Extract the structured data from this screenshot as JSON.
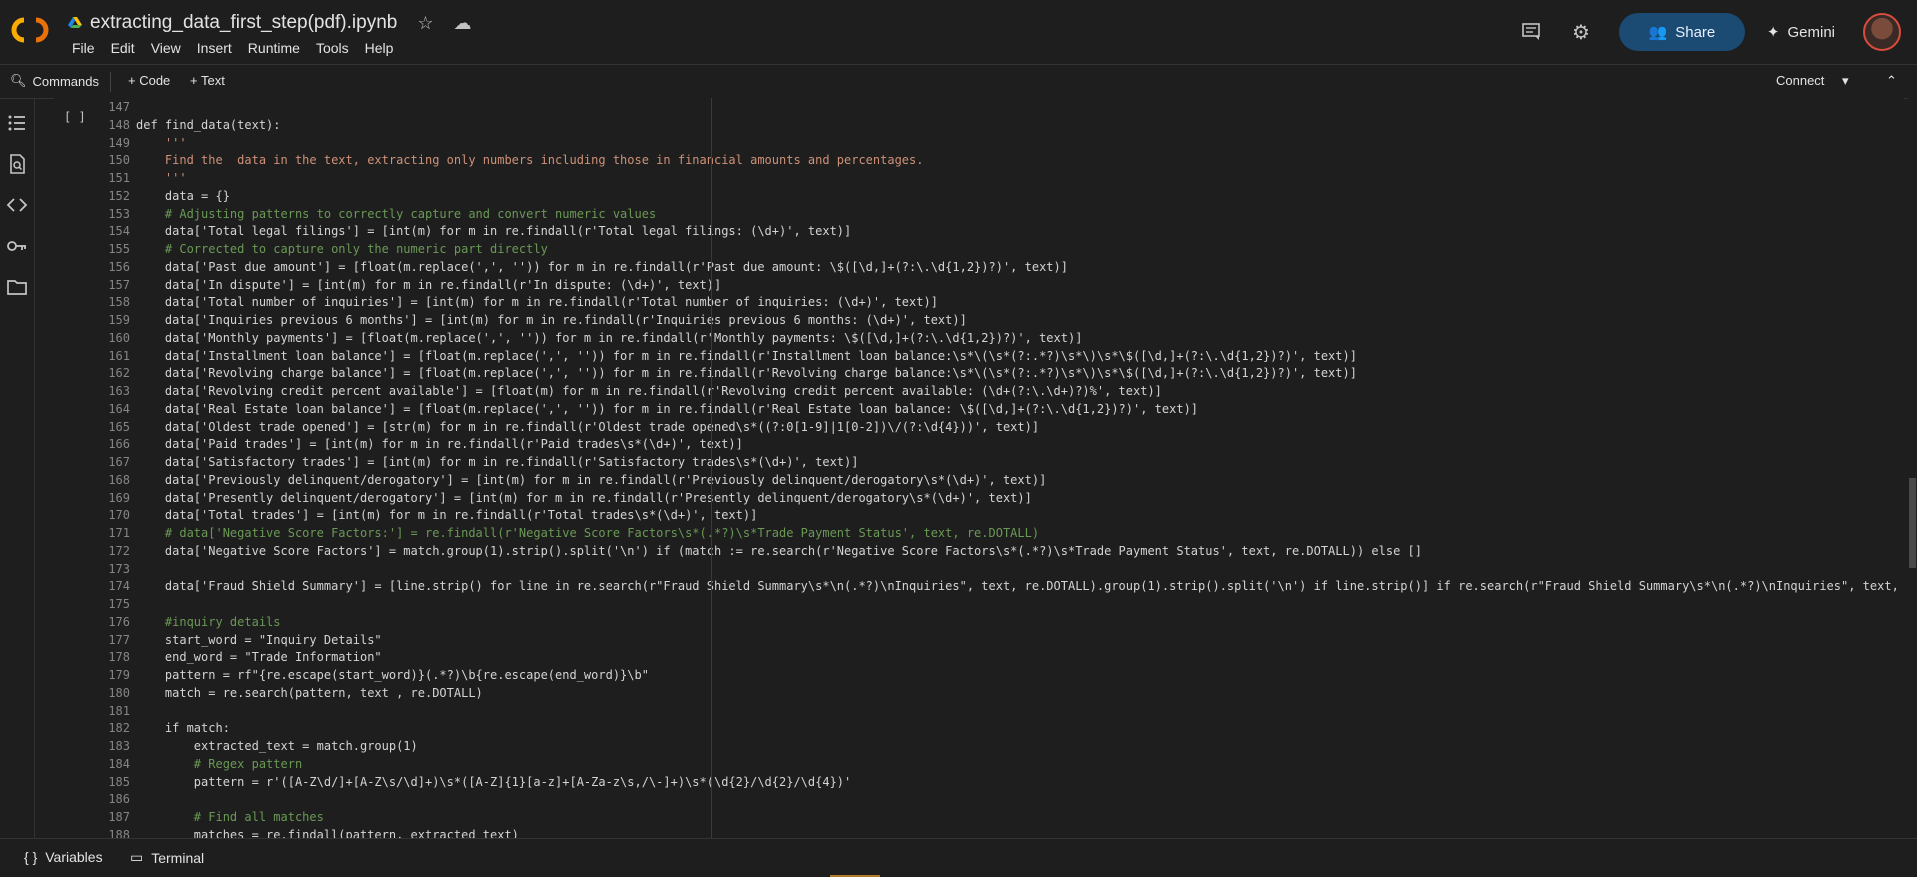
{
  "app": {
    "notebook_title": "extracting_data_first_step(pdf).ipynb",
    "menu": [
      "File",
      "Edit",
      "View",
      "Insert",
      "Runtime",
      "Tools",
      "Help"
    ],
    "share_label": "Share",
    "gemini_label": "Gemini"
  },
  "toolbar": {
    "commands_label": "Commands",
    "code_label": "+ Code",
    "text_label": "+ Text",
    "connect_label": "Connect"
  },
  "cell": {
    "run_indicator": "[ ]",
    "lines": [
      {
        "n": "147",
        "t": ""
      },
      {
        "n": "148",
        "t": "def find_data(text):"
      },
      {
        "n": "149",
        "t": "    '''"
      },
      {
        "n": "150",
        "t": "    Find the  data in the text, extracting only numbers including those in financial amounts and percentages."
      },
      {
        "n": "151",
        "t": "    '''"
      },
      {
        "n": "152",
        "t": "    data = {}"
      },
      {
        "n": "153",
        "t": "    # Adjusting patterns to correctly capture and convert numeric values"
      },
      {
        "n": "154",
        "t": "    data['Total legal filings'] = [int(m) for m in re.findall(r'Total legal filings: (\\d+)', text)]"
      },
      {
        "n": "155",
        "t": "    # Corrected to capture only the numeric part directly"
      },
      {
        "n": "156",
        "t": "    data['Past due amount'] = [float(m.replace(',', '')) for m in re.findall(r'Past due amount: \\$([\\d,]+(?:\\.\\d{1,2})?)', text)]"
      },
      {
        "n": "157",
        "t": "    data['In dispute'] = [int(m) for m in re.findall(r'In dispute: (\\d+)', text)]"
      },
      {
        "n": "158",
        "t": "    data['Total number of inquiries'] = [int(m) for m in re.findall(r'Total number of inquiries: (\\d+)', text)]"
      },
      {
        "n": "159",
        "t": "    data['Inquiries previous 6 months'] = [int(m) for m in re.findall(r'Inquiries previous 6 months: (\\d+)', text)]"
      },
      {
        "n": "160",
        "t": "    data['Monthly payments'] = [float(m.replace(',', '')) for m in re.findall(r'Monthly payments: \\$([\\d,]+(?:\\.\\d{1,2})?)', text)]"
      },
      {
        "n": "161",
        "t": "    data['Installment loan balance'] = [float(m.replace(',', '')) for m in re.findall(r'Installment loan balance:\\s*\\(\\s*(?:.*?)\\s*\\)\\s*\\$([\\d,]+(?:\\.\\d{1,2})?)', text)]"
      },
      {
        "n": "162",
        "t": "    data['Revolving charge balance'] = [float(m.replace(',', '')) for m in re.findall(r'Revolving charge balance:\\s*\\(\\s*(?:.*?)\\s*\\)\\s*\\$([\\d,]+(?:\\.\\d{1,2})?)', text)]"
      },
      {
        "n": "163",
        "t": "    data['Revolving credit percent available'] = [float(m) for m in re.findall(r'Revolving credit percent available: (\\d+(?:\\.\\d+)?)%', text)]"
      },
      {
        "n": "164",
        "t": "    data['Real Estate loan balance'] = [float(m.replace(',', '')) for m in re.findall(r'Real Estate loan balance: \\$([\\d,]+(?:\\.\\d{1,2})?)', text)]"
      },
      {
        "n": "165",
        "t": "    data['Oldest trade opened'] = [str(m) for m in re.findall(r'Oldest trade opened\\s*((?:0[1-9]|1[0-2])\\/(?:\\d{4}))', text)]"
      },
      {
        "n": "166",
        "t": "    data['Paid trades'] = [int(m) for m in re.findall(r'Paid trades\\s*(\\d+)', text)]"
      },
      {
        "n": "167",
        "t": "    data['Satisfactory trades'] = [int(m) for m in re.findall(r'Satisfactory trades\\s*(\\d+)', text)]"
      },
      {
        "n": "168",
        "t": "    data['Previously delinquent/derogatory'] = [int(m) for m in re.findall(r'Previously delinquent/derogatory\\s*(\\d+)', text)]"
      },
      {
        "n": "169",
        "t": "    data['Presently delinquent/derogatory'] = [int(m) for m in re.findall(r'Presently delinquent/derogatory\\s*(\\d+)', text)]"
      },
      {
        "n": "170",
        "t": "    data['Total trades'] = [int(m) for m in re.findall(r'Total trades\\s*(\\d+)', text)]"
      },
      {
        "n": "171",
        "t": "    # data['Negative Score Factors:'] = re.findall(r'Negative Score Factors\\s*(.*?)\\s*Trade Payment Status', text, re.DOTALL)"
      },
      {
        "n": "172",
        "t": "    data['Negative Score Factors'] = match.group(1).strip().split('\\n') if (match := re.search(r'Negative Score Factors\\s*(.*?)\\s*Trade Payment Status', text, re.DOTALL)) else []"
      },
      {
        "n": "173",
        "t": ""
      },
      {
        "n": "174",
        "t": "    data['Fraud Shield Summary'] = [line.strip() for line in re.search(r\"Fraud Shield Summary\\s*\\n(.*?)\\nInquiries\", text, re.DOTALL).group(1).strip().split('\\n') if line.strip()] if re.search(r\"Fraud Shield Summary\\s*\\n(.*?)\\nInquiries\", text,"
      },
      {
        "n": "175",
        "t": ""
      },
      {
        "n": "176",
        "t": "    #inquiry details"
      },
      {
        "n": "177",
        "t": "    start_word = \"Inquiry Details\""
      },
      {
        "n": "178",
        "t": "    end_word = \"Trade Information\""
      },
      {
        "n": "179",
        "t": "    pattern = rf\"{re.escape(start_word)}(.*?)\\b{re.escape(end_word)}\\b\""
      },
      {
        "n": "180",
        "t": "    match = re.search(pattern, text , re.DOTALL)"
      },
      {
        "n": "181",
        "t": ""
      },
      {
        "n": "182",
        "t": "    if match:"
      },
      {
        "n": "183",
        "t": "        extracted_text = match.group(1)"
      },
      {
        "n": "184",
        "t": "        # Regex pattern"
      },
      {
        "n": "185",
        "t": "        pattern = r'([A-Z\\d/]+[A-Z\\s/\\d]+)\\s*([A-Z]{1}[a-z]+[A-Za-z\\s,/\\-]+)\\s*(\\d{2}/\\d{2}/\\d{4})'"
      },
      {
        "n": "186",
        "t": ""
      },
      {
        "n": "187",
        "t": "        # Find all matches"
      },
      {
        "n": "188",
        "t": "        matches = re.findall(pattern, extracted_text)"
      }
    ]
  },
  "statusbar": {
    "variables_label": "Variables",
    "terminal_label": "Terminal"
  }
}
